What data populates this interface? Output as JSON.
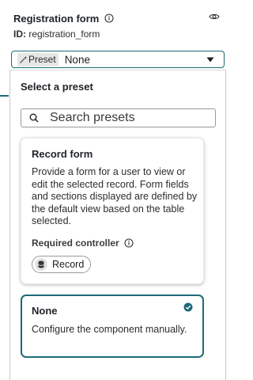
{
  "header": {
    "title": "Registration form",
    "id_label": "ID:",
    "id_value": "registration_form"
  },
  "preset_select": {
    "tag_label": "Preset",
    "value": "None"
  },
  "panel": {
    "title": "Select a preset",
    "search_placeholder": "Search presets"
  },
  "cards": [
    {
      "title": "Record form",
      "description": "Provide a form for a user to view or edit the selected record. Form fields and sections displayed are defined by the default view based on the table selected.",
      "required_label": "Required controller",
      "chip_label": "Record",
      "selected": false
    },
    {
      "title": "None",
      "description": "Configure the component manually.",
      "selected": true
    }
  ],
  "colors": {
    "accent": "#1d6b78",
    "text": "#1f2328",
    "border": "#9a9a9a"
  },
  "icons": [
    "info-icon",
    "eye-icon",
    "wand-icon",
    "chevron-down-icon",
    "search-icon",
    "database-icon",
    "check-circle-icon"
  ]
}
